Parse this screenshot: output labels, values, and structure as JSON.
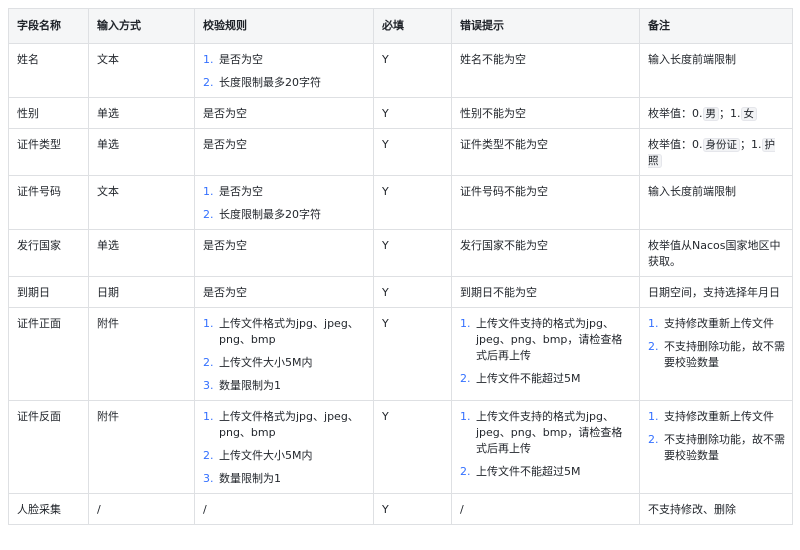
{
  "headers": [
    "字段名称",
    "输入方式",
    "校验规则",
    "必填",
    "错误提示",
    "备注"
  ],
  "rows": [
    {
      "field": "姓名",
      "input": "文本",
      "rules": [
        "是否为空",
        "长度限制最多20字符"
      ],
      "required": "Y",
      "error": "姓名不能为空",
      "note": "输入长度前端限制"
    },
    {
      "field": "性别",
      "input": "单选",
      "rule": "是否为空",
      "required": "Y",
      "error": "性别不能为空",
      "note_parts": [
        "枚举值：0.",
        "男",
        "；1.",
        "女"
      ]
    },
    {
      "field": "证件类型",
      "input": "单选",
      "rule": "是否为空",
      "required": "Y",
      "error": "证件类型不能为空",
      "note_parts": [
        "枚举值：0.",
        "身份证",
        "；1.",
        "护照"
      ]
    },
    {
      "field": "证件号码",
      "input": "文本",
      "rules": [
        "是否为空",
        "长度限制最多20字符"
      ],
      "required": "Y",
      "error": "证件号码不能为空",
      "note": "输入长度前端限制"
    },
    {
      "field": "发行国家",
      "input": "单选",
      "rule": "是否为空",
      "required": "Y",
      "error": "发行国家不能为空",
      "note": "枚举值从Nacos国家地区中获取。"
    },
    {
      "field": "到期日",
      "input": "日期",
      "rule": "是否为空",
      "required": "Y",
      "error": "到期日不能为空",
      "note": "日期空间，支持选择年月日"
    },
    {
      "field": "证件正面",
      "input": "附件",
      "rules": [
        "上传文件格式为jpg、jpeg、png、bmp",
        "上传文件大小5M内",
        "数量限制为1"
      ],
      "required": "Y",
      "errors": [
        "上传文件支持的格式为jpg、jpeg、png、bmp，请检查格式后再上传",
        "上传文件不能超过5M"
      ],
      "notes": [
        "支持修改重新上传文件",
        "不支持删除功能，故不需要校验数量"
      ]
    },
    {
      "field": "证件反面",
      "input": "附件",
      "rules": [
        "上传文件格式为jpg、jpeg、png、bmp",
        "上传文件大小5M内",
        "数量限制为1"
      ],
      "required": "Y",
      "errors": [
        "上传文件支持的格式为jpg、jpeg、png、bmp，请检查格式后再上传",
        "上传文件不能超过5M"
      ],
      "notes": [
        "支持修改重新上传文件",
        "不支持删除功能，故不需要校验数量"
      ]
    },
    {
      "field": "人脸采集",
      "input": "/",
      "rule": "/",
      "required": "Y",
      "error": "/",
      "note": "不支持修改、删除"
    }
  ],
  "colors": {
    "border": "#dee0e3",
    "header_bg": "#f5f6f7",
    "list_number": "#3370ff"
  }
}
